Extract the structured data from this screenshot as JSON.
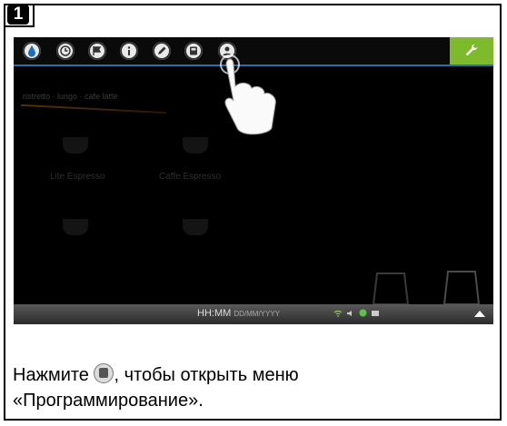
{
  "step": {
    "number": "1"
  },
  "screen": {
    "toolbar_icons": [
      {
        "name": "water-drop-icon"
      },
      {
        "name": "clock-icon"
      },
      {
        "name": "flag-icon"
      },
      {
        "name": "info-icon"
      },
      {
        "name": "pencil-icon"
      },
      {
        "name": "programming-icon"
      },
      {
        "name": "user-icon"
      }
    ],
    "wrench_color": "#7dbb2d",
    "menu_text": "ristretto · lungo · cafe latte",
    "products": [
      "Lite Espresso",
      "Caffe Espresso"
    ],
    "status": {
      "time": "HH:MM",
      "date": "DD/MM/YYYY"
    }
  },
  "caption": {
    "before": "Нажмите ",
    "after": ", чтобы открыть меню «Программирование»."
  }
}
